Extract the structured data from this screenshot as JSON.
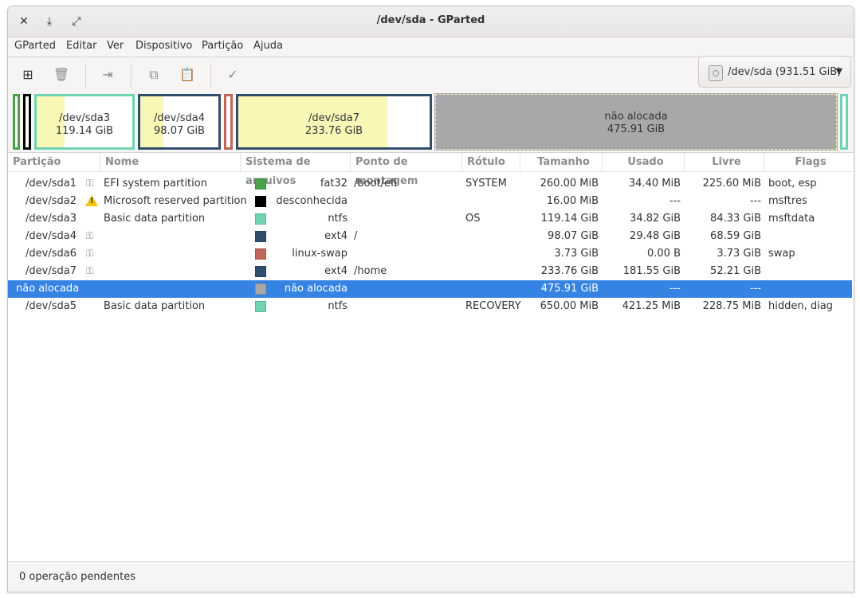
{
  "window": {
    "title": "/dev/sda - GParted"
  },
  "menu": [
    "GParted",
    "Editar",
    "Ver",
    "Dispositivo",
    "Partição",
    "Ajuda"
  ],
  "toolbar": {
    "new_icon": "new-partition-icon",
    "delete_icon": "delete-icon",
    "resize_icon": "resize-move-icon",
    "copy_icon": "copy-icon",
    "paste_icon": "paste-icon",
    "apply_icon": "apply-checkmark-icon"
  },
  "device": {
    "label": "/dev/sda (931.51 GiB)"
  },
  "diskmap": {
    "sda3": {
      "name": "/dev/sda3",
      "size": "119.14 GiB",
      "used_fraction": 0.29
    },
    "sda4": {
      "name": "/dev/sda4",
      "size": "98.07 GiB",
      "used_fraction": 0.3
    },
    "sda7": {
      "name": "/dev/sda7",
      "size": "233.76 GiB",
      "used_fraction": 0.78
    },
    "unalloc": {
      "name": "não alocada",
      "size": "475.91 GiB"
    }
  },
  "table": {
    "headers": [
      "Partição",
      "Nome",
      "Sistema de arquivos",
      "Ponto de montagem",
      "Rótulo",
      "Tamanho",
      "Usado",
      "Livre",
      "Flags"
    ],
    "rows": [
      {
        "part": "/dev/sda1",
        "name": "EFI system partition",
        "fs": "fat32",
        "mount": "/boot/efi",
        "label": "SYSTEM",
        "size": "260.00 MiB",
        "used": "34.40 MiB",
        "free": "225.60 MiB",
        "flags": "boot, esp"
      },
      {
        "part": "/dev/sda2",
        "name": "Microsoft reserved partition",
        "fs": "desconhecida",
        "mount": "",
        "label": "",
        "size": "16.00 MiB",
        "used": "---",
        "free": "---",
        "flags": "msftres"
      },
      {
        "part": "/dev/sda3",
        "name": "Basic data partition",
        "fs": "ntfs",
        "mount": "",
        "label": "OS",
        "size": "119.14 GiB",
        "used": "34.82 GiB",
        "free": "84.33 GiB",
        "flags": "msftdata"
      },
      {
        "part": "/dev/sda4",
        "name": "",
        "fs": "ext4",
        "mount": "/",
        "label": "",
        "size": "98.07 GiB",
        "used": "29.48 GiB",
        "free": "68.59 GiB",
        "flags": ""
      },
      {
        "part": "/dev/sda6",
        "name": "",
        "fs": "linux-swap",
        "mount": "",
        "label": "",
        "size": "3.73 GiB",
        "used": "0.00 B",
        "free": "3.73 GiB",
        "flags": "swap"
      },
      {
        "part": "/dev/sda7",
        "name": "",
        "fs": "ext4",
        "mount": "/home",
        "label": "",
        "size": "233.76 GiB",
        "used": "181.55 GiB",
        "free": "52.21 GiB",
        "flags": ""
      },
      {
        "part": "não alocada",
        "name": "",
        "fs": "não alocada",
        "mount": "",
        "label": "",
        "size": "475.91 GiB",
        "used": "---",
        "free": "---",
        "flags": ""
      },
      {
        "part": "/dev/sda5",
        "name": "Basic data partition",
        "fs": "ntfs",
        "mount": "",
        "label": "RECOVERY",
        "size": "650.00 MiB",
        "used": "421.25 MiB",
        "free": "228.75 MiB",
        "flags": "hidden, diag"
      }
    ]
  },
  "colors": {
    "fat32": "#4ba04b",
    "unknown": "#000000",
    "ntfs": "#6fd4b4",
    "ext4": "#314e6c",
    "swap": "#c1665a",
    "unalloc": "#a8a8a8",
    "selection": "#3584e4"
  },
  "status": "0 operação pendentes"
}
